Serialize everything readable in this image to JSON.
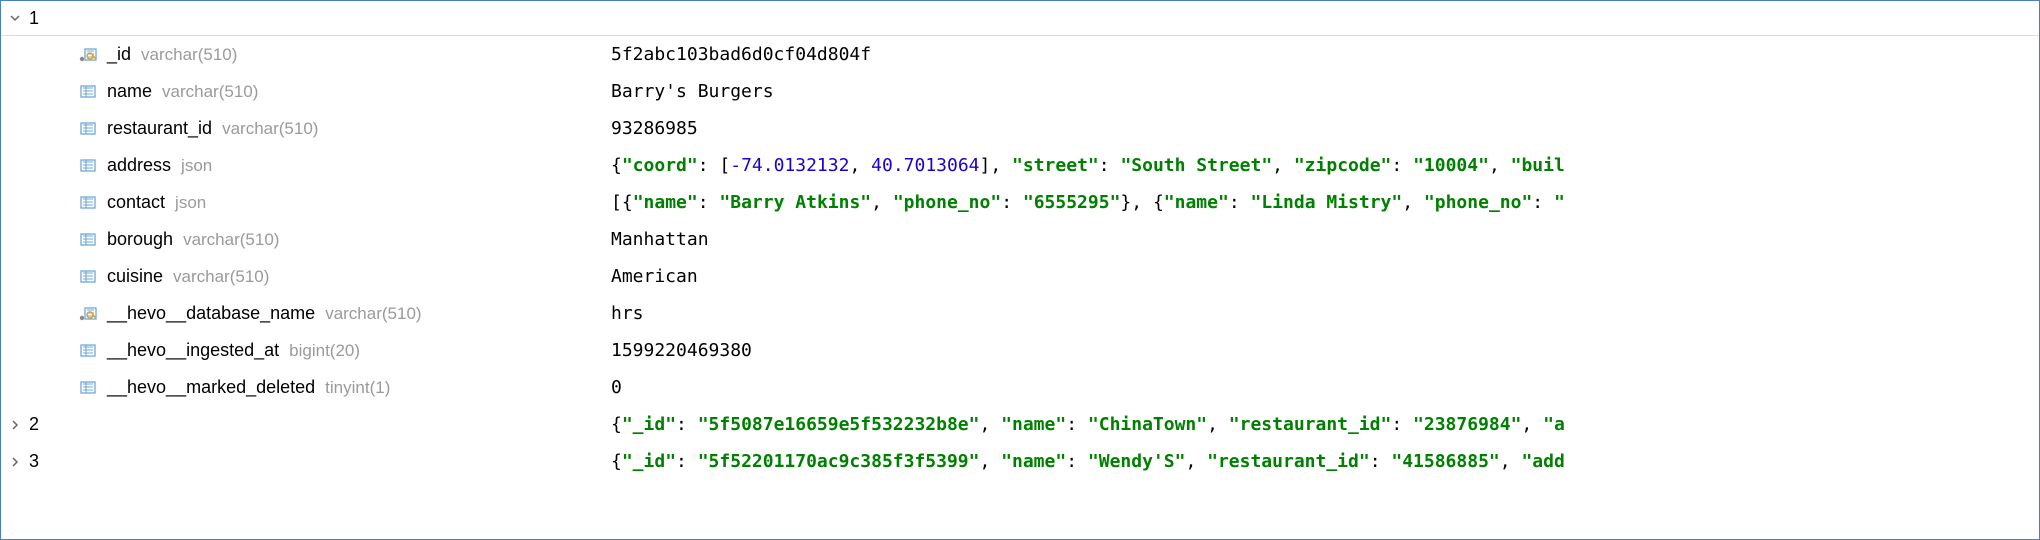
{
  "rows": {
    "r1": {
      "num": "1"
    },
    "r2": {
      "num": "2"
    },
    "r3": {
      "num": "3"
    }
  },
  "fields": [
    {
      "name": "_id",
      "type": "varchar(510)",
      "value_plain": "5f2abc103bad6d0cf04d804f",
      "icon": "key"
    },
    {
      "name": "name",
      "type": "varchar(510)",
      "value_plain": "Barry's Burgers",
      "icon": "col"
    },
    {
      "name": "restaurant_id",
      "type": "varchar(510)",
      "value_plain": "93286985",
      "icon": "col"
    },
    {
      "name": "address",
      "type": "json",
      "icon": "col"
    },
    {
      "name": "contact",
      "type": "json",
      "icon": "col"
    },
    {
      "name": "borough",
      "type": "varchar(510)",
      "value_plain": "Manhattan",
      "icon": "col"
    },
    {
      "name": "cuisine",
      "type": "varchar(510)",
      "value_plain": "American",
      "icon": "col"
    },
    {
      "name": "__hevo__database_name",
      "type": "varchar(510)",
      "value_plain": "hrs",
      "icon": "key"
    },
    {
      "name": "__hevo__ingested_at",
      "type": "bigint(20)",
      "value_plain": "1599220469380",
      "icon": "col"
    },
    {
      "name": "__hevo__marked_deleted",
      "type": "tinyint(1)",
      "value_plain": "0",
      "icon": "col"
    }
  ],
  "json_values": {
    "address": {
      "coord": [
        -74.0132132,
        40.7013064
      ],
      "street": "South Street",
      "zipcode": "10004",
      "truncated_key": "buil"
    },
    "contact": [
      {
        "name": "Barry Atkins",
        "phone_no": "6555295"
      },
      {
        "name": "Linda Mistry",
        "phone_no_truncated": true
      }
    ]
  },
  "collapsed_rows": {
    "row2": {
      "_id": "5f5087e16659e5f532232b8e",
      "name": "ChinaTown",
      "restaurant_id": "23876984",
      "truncated_key": "a"
    },
    "row3": {
      "_id": "5f52201170ac9c385f3f5399",
      "name": "Wendy'S",
      "restaurant_id": "41586885",
      "truncated_key": "add"
    }
  },
  "labels": {
    "coord": "\"coord\"",
    "street": "\"street\"",
    "zipcode": "\"zipcode\"",
    "name": "\"name\"",
    "phone_no": "\"phone_no\"",
    "_id": "\"_id\"",
    "restaurant_id": "\"restaurant_id\""
  },
  "strings": {
    "south_street": "\"South Street\"",
    "zip10004": "\"10004\"",
    "buil": "\"buil",
    "barry_atkins": "\"Barry Atkins\"",
    "p6555295": "\"6555295\"",
    "linda_mistry": "\"Linda Mistry\"",
    "quote_trail": "\"",
    "r2_id": "\"5f5087e16659e5f532232b8e\"",
    "r2_name": "\"ChinaTown\"",
    "r2_rid": "\"23876984\"",
    "r2_a": "\"a",
    "r3_id": "\"5f52201170ac9c385f3f5399\"",
    "r3_name": "\"Wendy'S\"",
    "r3_rid": "\"41586885\"",
    "r3_add": "\"add"
  },
  "nums": {
    "lon": "-74.0132132",
    "lat": "40.7013064"
  },
  "punct": {
    "lbrace": "{",
    "rbrace": "}",
    "lbrack": "[",
    "rbrack": "]",
    "colon_sp": ": ",
    "comma_sp": ", "
  }
}
